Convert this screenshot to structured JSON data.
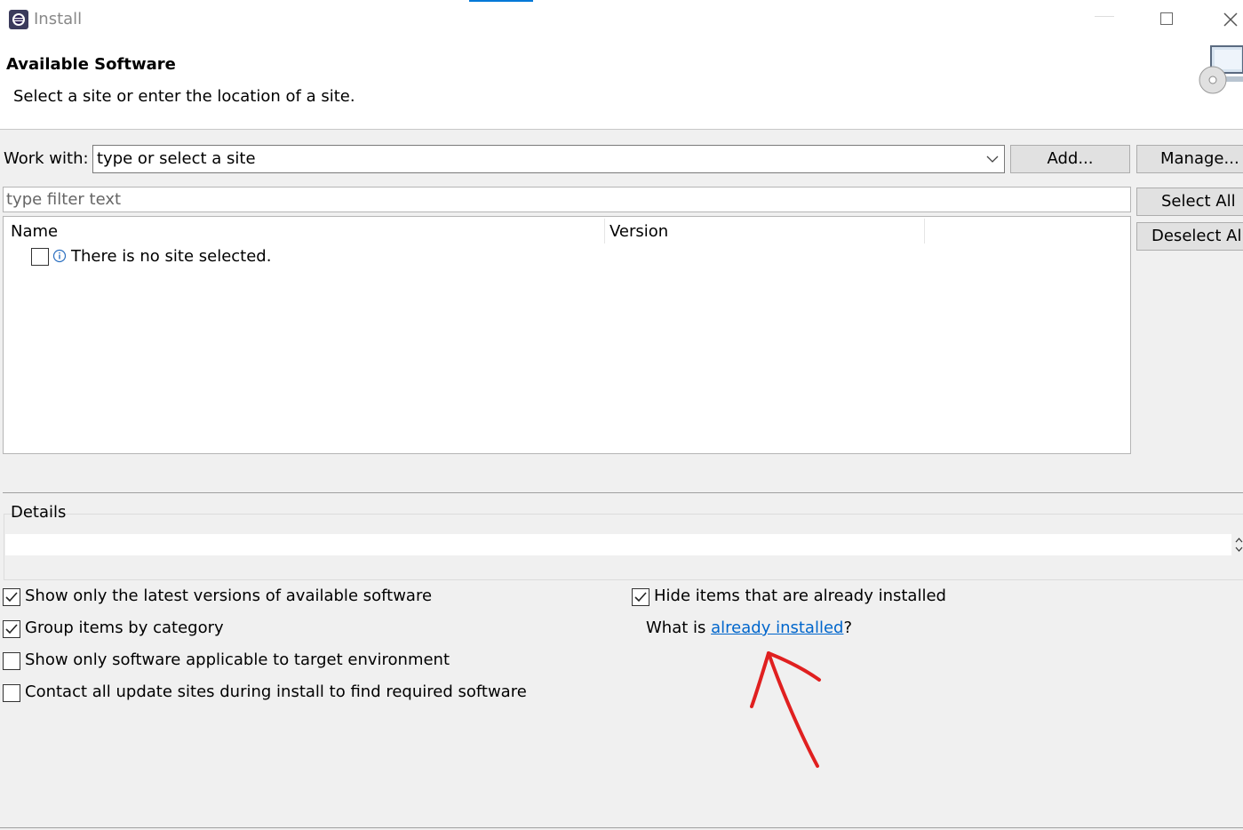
{
  "window": {
    "title": "Install"
  },
  "header": {
    "title": "Available Software",
    "description": "Select a site or enter the location of a site."
  },
  "work_with": {
    "label": "Work with:",
    "value": "type or select a site",
    "add_label": "Add...",
    "manage_label": "Manage..."
  },
  "filter": {
    "placeholder": "type filter text"
  },
  "buttons": {
    "select_all": "Select All",
    "deselect_all": "Deselect All"
  },
  "table": {
    "columns": [
      "Name",
      "Version"
    ],
    "rows": [
      {
        "text": "There is no site selected.",
        "checked": false
      }
    ]
  },
  "details": {
    "label": "Details",
    "text": ""
  },
  "options": {
    "latest": {
      "label": "Show only the latest versions of available software",
      "checked": true
    },
    "group": {
      "label": "Group items by category",
      "checked": true
    },
    "target": {
      "label": "Show only software applicable to target environment",
      "checked": false
    },
    "contact": {
      "label": "Contact all update sites during install to find required software",
      "checked": false
    },
    "hide": {
      "label": "Hide items that are already installed",
      "checked": true
    }
  },
  "installed": {
    "prefix": "What is ",
    "link": "already installed",
    "suffix": "?"
  },
  "colors": {
    "link": "#0066cc",
    "annotation": "#e02020",
    "accent": "#0078d7"
  }
}
